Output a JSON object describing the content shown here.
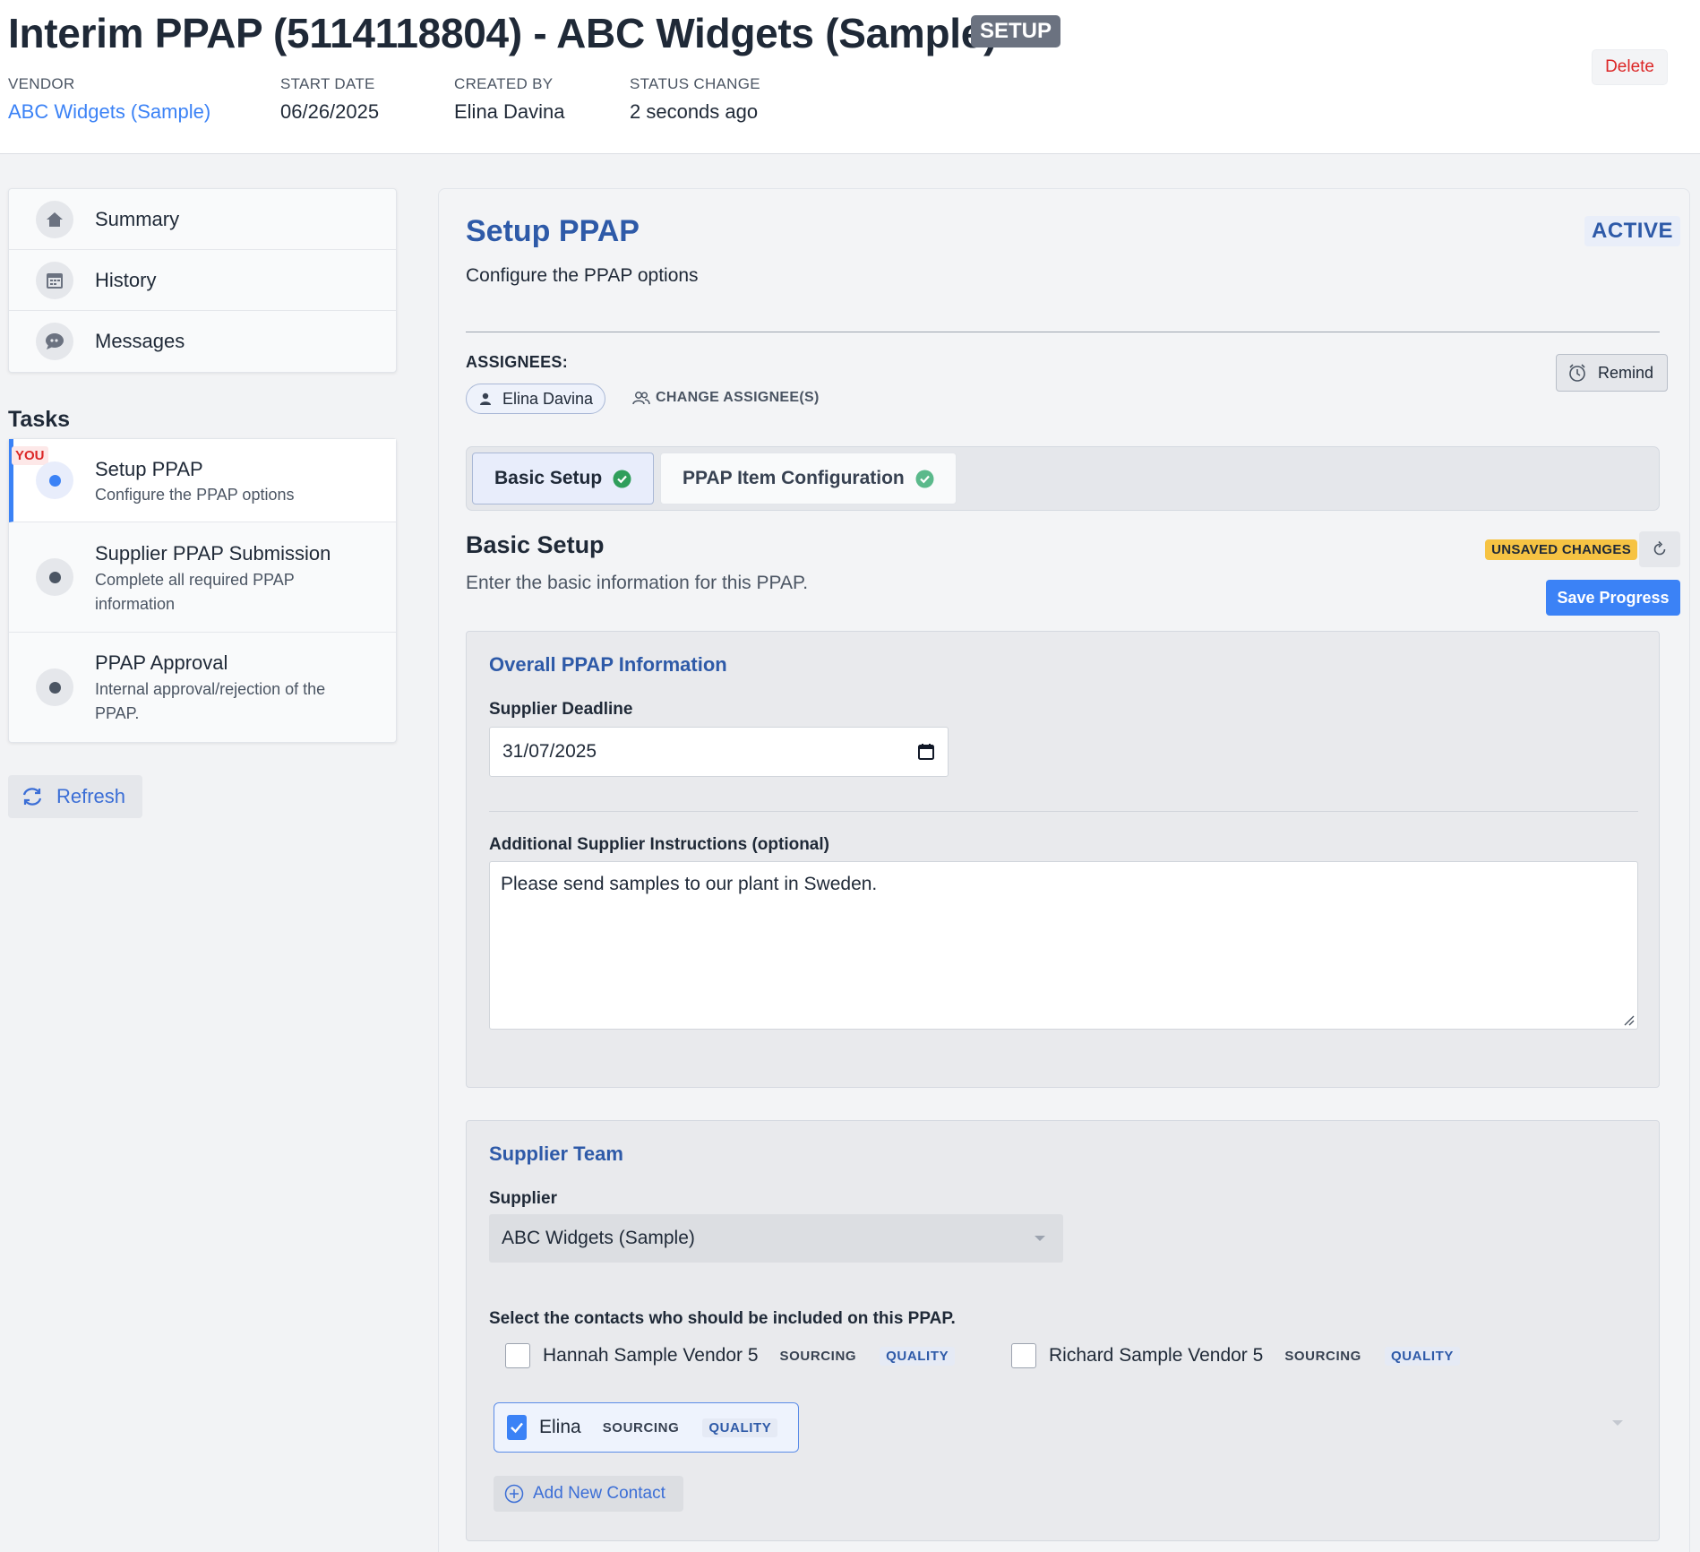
{
  "header": {
    "title": "Interim PPAP (5114118804) - ABC Widgets (Sample)",
    "stage_badge": "SETUP",
    "delete_label": "Delete",
    "meta": [
      {
        "label": "VENDOR",
        "value": "ABC Widgets (Sample)"
      },
      {
        "label": "START DATE",
        "value": "06/26/2025"
      },
      {
        "label": "CREATED BY",
        "value": "Elina Davina"
      },
      {
        "label": "STATUS CHANGE",
        "value": "2 seconds ago"
      }
    ]
  },
  "sidebar": {
    "nav": [
      {
        "label": "Summary",
        "icon": "home-icon"
      },
      {
        "label": "History",
        "icon": "calendar-icon"
      },
      {
        "label": "Messages",
        "icon": "chat-icon"
      }
    ],
    "tasks_heading": "Tasks",
    "you_badge": "YOU",
    "tasks": [
      {
        "name": "Setup PPAP",
        "desc": "Configure the PPAP options",
        "active": true
      },
      {
        "name": "Supplier PPAP Submission",
        "desc": "Complete all required PPAP information",
        "active": false
      },
      {
        "name": "PPAP Approval",
        "desc": "Internal approval/rejection of the PPAP.",
        "active": false
      }
    ],
    "refresh_label": "Refresh"
  },
  "main": {
    "title": "Setup PPAP",
    "status": "ACTIVE",
    "subtitle": "Configure the PPAP options",
    "assignees_label": "ASSIGNEES:",
    "assignee": "Elina Davina",
    "change_assignee_label": "CHANGE ASSIGNEE(S)",
    "remind_label": "Remind",
    "tabs": [
      {
        "label": "Basic Setup",
        "complete": true,
        "selected": true
      },
      {
        "label": "PPAP Item Configuration",
        "complete": true,
        "selected": false
      }
    ],
    "section_title": "Basic Setup",
    "section_sub": "Enter the basic information for this PPAP.",
    "unsaved_label": "UNSAVED CHANGES",
    "save_label": "Save Progress",
    "overall": {
      "heading": "Overall PPAP Information",
      "deadline_label": "Supplier Deadline",
      "deadline_value": "31/07/2025",
      "instructions_label": "Additional Supplier Instructions (optional)",
      "instructions_value": "Please send samples to our plant in Sweden."
    },
    "team": {
      "heading": "Supplier Team",
      "supplier_label": "Supplier",
      "supplier_value": "ABC Widgets (Sample)",
      "contacts_heading": "Select the contacts who should be included on this PPAP.",
      "contacts": [
        {
          "name": "Hannah Sample Vendor 5",
          "tag1": "SOURCING",
          "tag2": "QUALITY",
          "checked": false
        },
        {
          "name": "Richard Sample Vendor 5",
          "tag1": "SOURCING",
          "tag2": "QUALITY",
          "checked": false
        },
        {
          "name": "Elina",
          "tag1": "SOURCING",
          "tag2": "QUALITY",
          "checked": true
        }
      ],
      "add_contact_label": "Add New Contact"
    }
  },
  "colors": {
    "accent": "#3b82f6",
    "heading_blue": "#2e5aa8",
    "danger": "#dc2626",
    "unsaved": "#f6c343"
  }
}
